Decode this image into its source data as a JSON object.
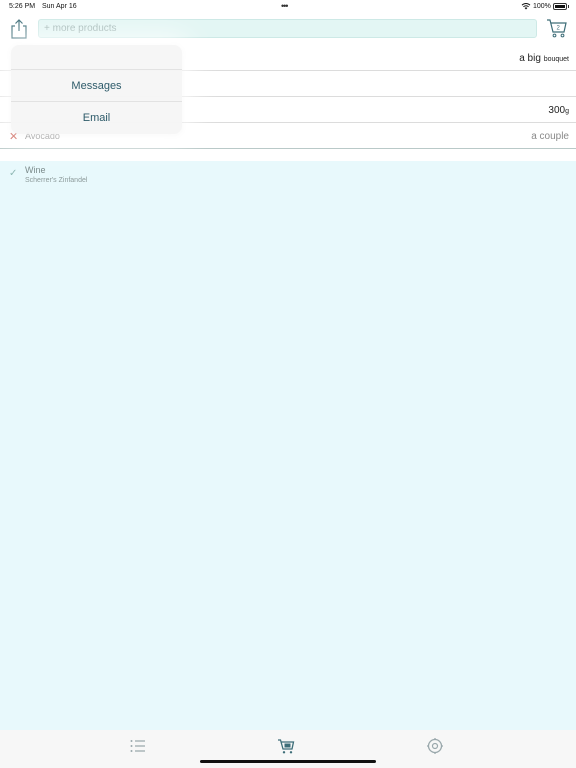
{
  "status_bar": {
    "time": "5:26 PM",
    "date": "Sun Apr 16",
    "battery": "100%"
  },
  "toolbar": {
    "search_placeholder": "+ more products"
  },
  "list": {
    "rows": [
      {
        "name": "",
        "qty_main": "a big",
        "qty_unit": "bouquet"
      },
      {
        "name": "",
        "qty_main": "",
        "qty_unit": ""
      },
      {
        "name": "",
        "qty_main": "300",
        "qty_unit": "g"
      },
      {
        "name": "Avocado",
        "qty_main": "a couple",
        "qty_unit": ""
      }
    ],
    "done_rows": [
      {
        "name": "Wine",
        "subtitle": "Scherrer's Zinfandel"
      }
    ]
  },
  "share_menu": {
    "items": [
      "Messages",
      "Email"
    ]
  },
  "colors": {
    "accent": "#2e5b6a",
    "done_background": "#e8f9fc",
    "search_background": "#e3f6f4",
    "remove_mark": "#c0392b"
  },
  "icons": {
    "share": "share-icon",
    "cart": "cart-icon",
    "list": "list-icon",
    "settings": "gear-icon"
  }
}
